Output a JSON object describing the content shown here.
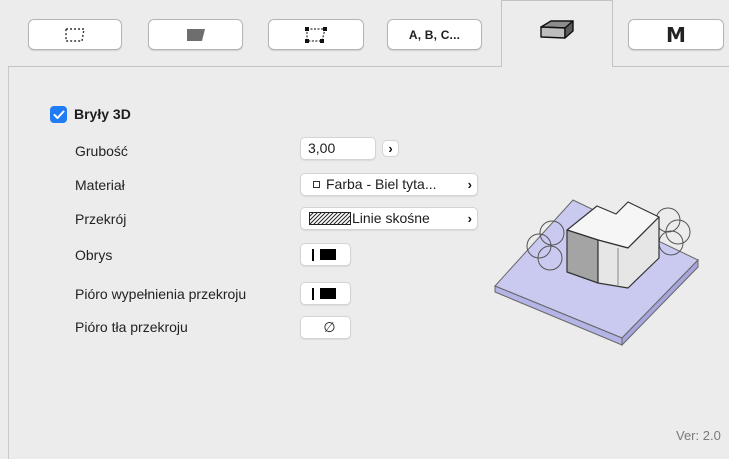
{
  "tabs": [
    {
      "id": "outline",
      "icon": "dashed-outline-icon"
    },
    {
      "id": "fill",
      "icon": "filled-shape-icon"
    },
    {
      "id": "vertices",
      "icon": "vertex-shape-icon"
    },
    {
      "id": "text",
      "label": "A, B, C..."
    },
    {
      "id": "solid",
      "icon": "3d-block-icon",
      "active": true
    },
    {
      "id": "model",
      "label": "M"
    }
  ],
  "section": {
    "title": "Bryły 3D",
    "checked": true
  },
  "rows": {
    "thickness": {
      "label": "Grubość",
      "value": "3,00"
    },
    "material": {
      "label": "Materiał",
      "value": "Farba - Biel tyta..."
    },
    "cut_fill": {
      "label": "Przekrój",
      "value": "Linie skośne"
    },
    "outline": {
      "label": "Obrys"
    },
    "cut_fill_pen": {
      "label": "Pióro wypełnienia przekroju"
    },
    "cut_bg_pen": {
      "label": "Pióro tła przekroju",
      "value": "∅"
    }
  },
  "version": "Ver: 2.0",
  "colors": {
    "accent": "#1f7cf5",
    "preview_slab": "#c9c9f0"
  }
}
